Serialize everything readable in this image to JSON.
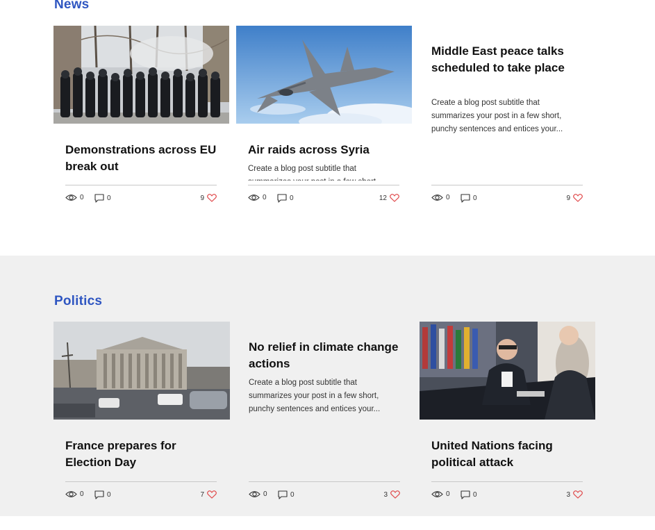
{
  "sections": {
    "news": {
      "title": "News",
      "posts": [
        {
          "title": "Demonstrations across EU break out",
          "subtitle": "",
          "views": "0",
          "comments": "0",
          "likes": "9"
        },
        {
          "title": "Air raids across Syria",
          "subtitle": "Create a blog post subtitle that summarizes your post in a few short",
          "views": "0",
          "comments": "0",
          "likes": "12"
        },
        {
          "title": "Middle East peace talks scheduled to take place",
          "subtitle": "Create a blog post subtitle that summarizes your post in a few short, punchy sentences and entices your...",
          "views": "0",
          "comments": "0",
          "likes": "9"
        }
      ]
    },
    "politics": {
      "title": "Politics",
      "posts": [
        {
          "title": "France prepares for Election Day",
          "subtitle": "",
          "views": "0",
          "comments": "0",
          "likes": "7"
        },
        {
          "title": "No relief in climate change actions",
          "subtitle": "Create a blog post subtitle that summarizes your post in a few short, punchy sentences and entices your...",
          "views": "0",
          "comments": "0",
          "likes": "3"
        },
        {
          "title": "United Nations facing political attack",
          "subtitle": "",
          "views": "0",
          "comments": "0",
          "likes": "3"
        }
      ]
    }
  },
  "icons": {
    "views": "eye-icon",
    "comments": "comment-icon",
    "likes": "heart-icon"
  },
  "colors": {
    "section_title": "#2f56c1",
    "heart": "#e0484a",
    "politics_background": "#f0f0f0"
  }
}
